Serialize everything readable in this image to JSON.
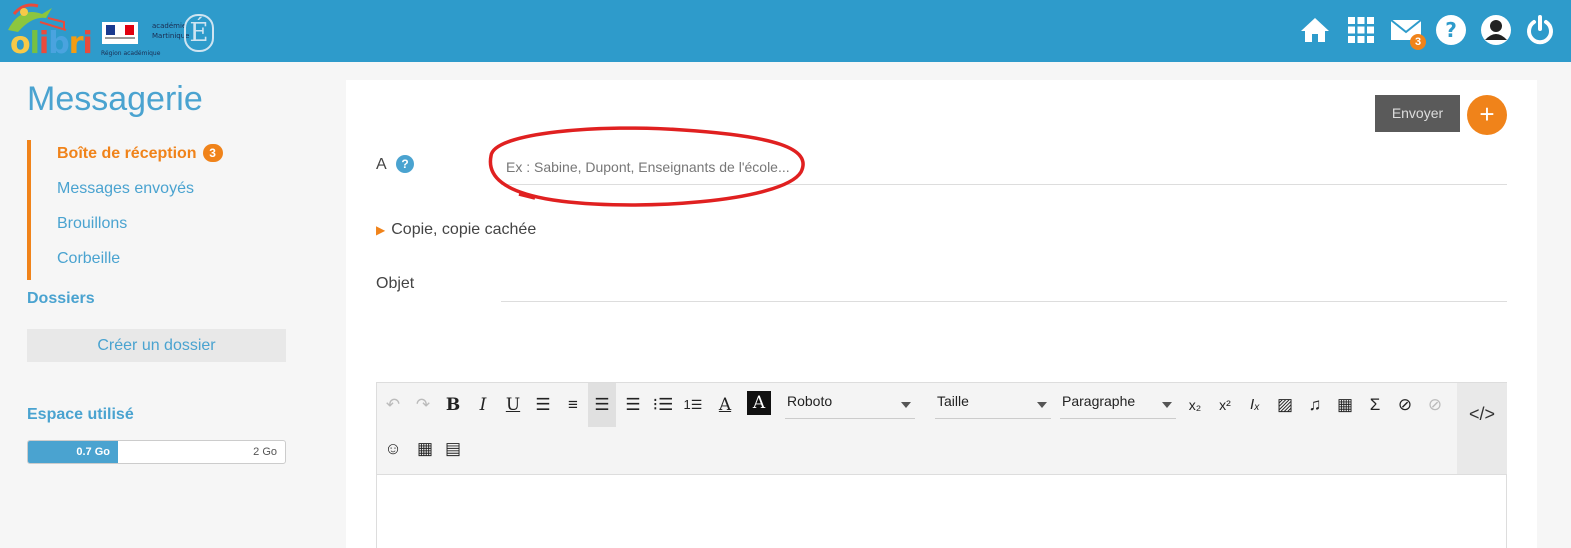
{
  "header": {
    "logo_text": "olibri",
    "academie_line1": "académie",
    "academie_line2": "Martinique",
    "region_tag": "Région académique",
    "icons": [
      "home-icon",
      "apps-grid-icon",
      "mail-icon",
      "help-icon",
      "user-icon",
      "power-icon"
    ],
    "mail_badge": "3"
  },
  "sidebar": {
    "title": "Messagerie",
    "folders": [
      {
        "label": "Boîte de réception",
        "badge": "3"
      },
      {
        "label": "Messages envoyés"
      },
      {
        "label": "Brouillons"
      },
      {
        "label": "Corbeille"
      }
    ],
    "dossiers_title": "Dossiers",
    "create_folder_label": "Créer un dossier",
    "space_title": "Espace utilisé",
    "space_used": "0.7 Go",
    "space_total": "2 Go",
    "space_fraction": 0.35
  },
  "compose": {
    "send_label": "Envoyer",
    "add_label": "+",
    "to_label": "A",
    "help_label": "?",
    "to_placeholder": "Ex : Sabine, Dupont, Enseignants de l'école...",
    "copy_label": "Copie, copie cachée",
    "subject_label": "Objet",
    "subject_value": ""
  },
  "editor": {
    "font_select": "Roboto",
    "size_select": "Taille",
    "block_select": "Paragraphe"
  },
  "colors": {
    "header_bg": "#2e9bcb",
    "accent_orange": "#f0831a",
    "link_blue": "#4aa3d0",
    "annotation_red": "#e02020"
  }
}
